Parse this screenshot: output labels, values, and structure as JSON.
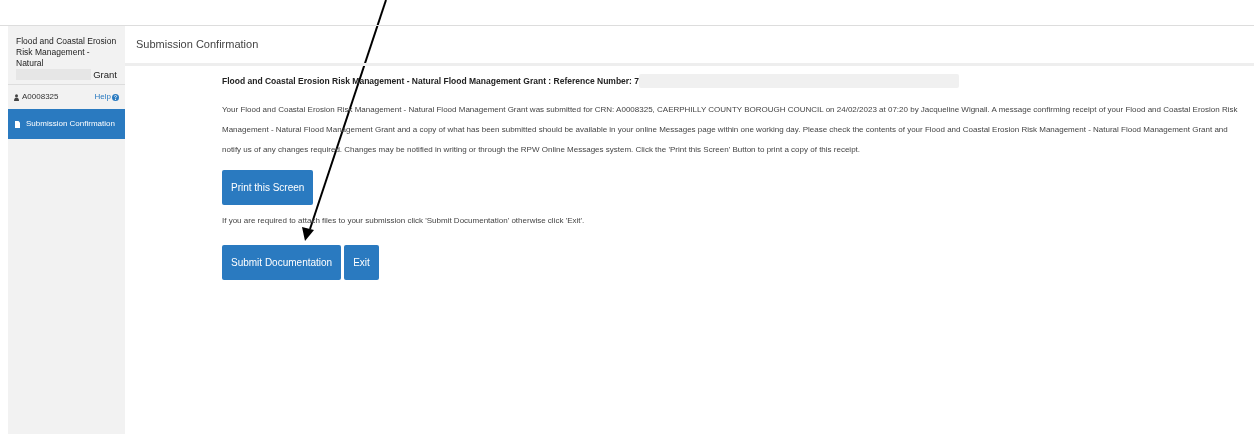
{
  "sidebar": {
    "title": "Flood and Coastal Erosion Risk Management - Natural",
    "title_end": "Grant",
    "user": "A0008325",
    "help": "Help",
    "items": [
      {
        "label": "Submission Confirmation",
        "selected": true
      }
    ]
  },
  "header": {
    "title": "Submission Confirmation"
  },
  "content": {
    "heading": "Flood and Coastal Erosion Risk Management - Natural Flood Management Grant : Reference Number: 7",
    "message": "Your Flood and Coastal Erosion Risk Management - Natural Flood Management Grant was submitted for CRN: A0008325, CAERPHILLY COUNTY BOROUGH COUNCIL on 24/02/2023 at 07:20 by Jacqueline Wignall. A message confirming receipt of your Flood and Coastal Erosion Risk Management - Natural Flood Management Grant and a copy of what has been submitted should be available in your online Messages page within one working day. Please check the contents of your Flood and Coastal Erosion Risk Management - Natural Flood Management Grant and notify us of any changes required. Changes may be notified in writing or through the RPW Online Messages system. Click the 'Print this Screen' Button to print a copy of this receipt.",
    "print_button": "Print this Screen",
    "instruction": "If you are required to attach files to your submission click 'Submit Documentation' otherwise click 'Exit'.",
    "buttons": [
      "Submit Documentation",
      "Exit"
    ]
  }
}
